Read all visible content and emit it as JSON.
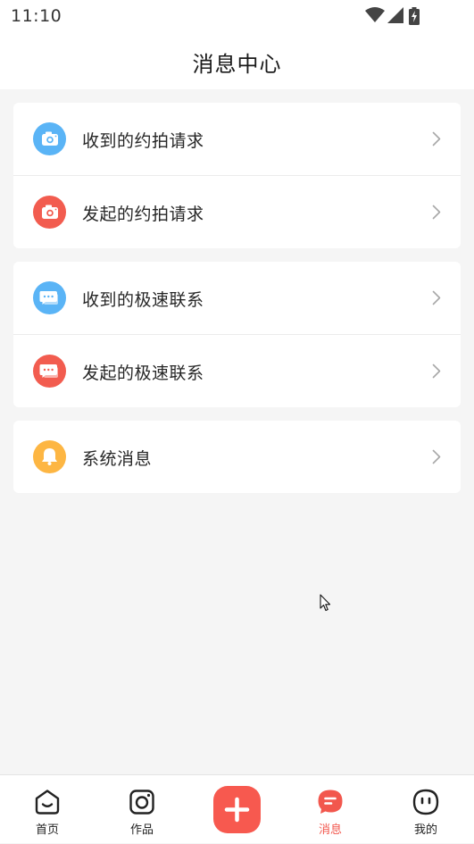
{
  "status_bar": {
    "time": "11:10"
  },
  "header": {
    "title": "消息中心"
  },
  "groups": [
    {
      "items": [
        {
          "label": "收到的约拍请求",
          "icon": "camera-icon",
          "color": "#5ab4f6"
        },
        {
          "label": "发起的约拍请求",
          "icon": "camera-icon",
          "color": "#f25c4f"
        }
      ]
    },
    {
      "items": [
        {
          "label": "收到的极速联系",
          "icon": "chat-icon",
          "color": "#5ab4f6"
        },
        {
          "label": "发起的极速联系",
          "icon": "chat-icon",
          "color": "#f25c4f"
        }
      ]
    },
    {
      "items": [
        {
          "label": "系统消息",
          "icon": "bell-icon",
          "color": "#fdb643"
        }
      ]
    }
  ],
  "tabs": [
    {
      "label": "首页",
      "icon": "home-face-icon",
      "active": false
    },
    {
      "label": "作品",
      "icon": "instagram-camera-icon",
      "active": false
    },
    {
      "label": "",
      "icon": "plus-icon",
      "active": false
    },
    {
      "label": "消息",
      "icon": "message-bubble-icon",
      "active": true
    },
    {
      "label": "我的",
      "icon": "profile-face-icon",
      "active": false
    }
  ],
  "colors": {
    "accent": "#f2574d",
    "blue": "#5ab4f6",
    "red": "#f25c4f",
    "yellow": "#fdb643"
  }
}
